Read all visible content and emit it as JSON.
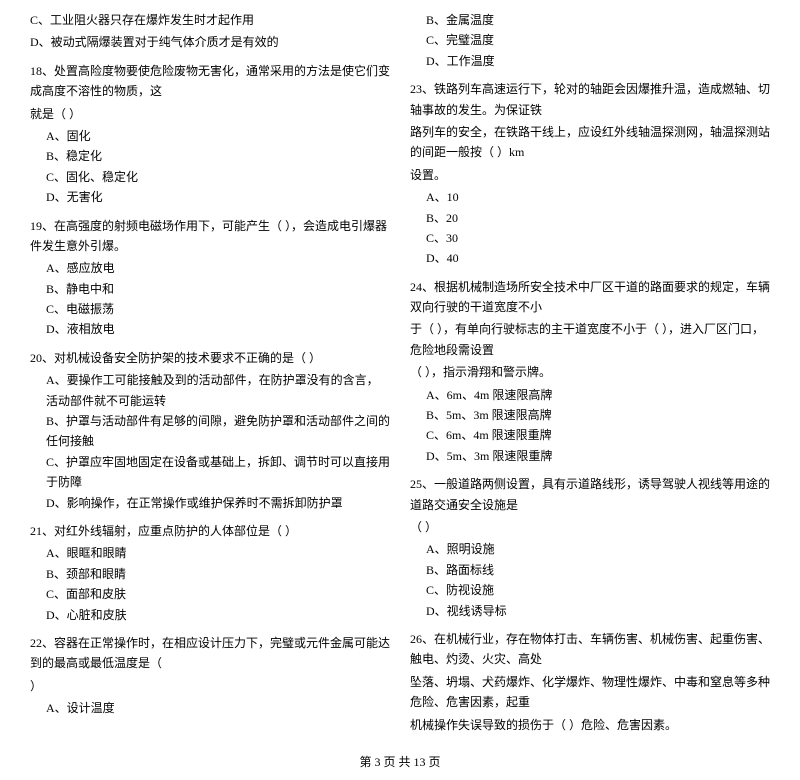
{
  "left_column": [
    {
      "id": "q_c_tool",
      "lines": [
        "C、工业阻火器只存在爆炸发生时才起作用",
        "D、被动式隔爆装置对于纯气体介质才是有效的"
      ],
      "options": []
    },
    {
      "id": "q18",
      "lines": [
        "18、处置高险度物要使危险废物无害化，通常采用的方法是使它们变成高度不溶性的物质，这",
        "就是（  ）"
      ],
      "options": [
        "A、固化",
        "B、稳定化",
        "C、固化、稳定化",
        "D、无害化"
      ]
    },
    {
      "id": "q19",
      "lines": [
        "19、在高强度的射频电磁场作用下，可能产生（    ），会造成电引爆器件发生意外引爆。"
      ],
      "options": [
        "A、感应放电",
        "B、静电中和",
        "C、电磁振荡",
        "D、液相放电"
      ]
    },
    {
      "id": "q20",
      "lines": [
        "20、对机械设备安全防护架的技术要求不正确的是（    ）"
      ],
      "options": [
        "A、要操作工可能接触及到的活动部件，在防护罩没有的含言，活动部件就不可能运转",
        "B、护罩与活动部件有足够的间隙，避免防护罩和活动部件之间的任何接触",
        "C、护罩应牢固地固定在设备或基础上，拆卸、调节时可以直接用于防障",
        "D、影响操作，在正常操作或维护保养时不需拆卸防护罩"
      ]
    },
    {
      "id": "q21",
      "lines": [
        "21、对红外线辐射，应重点防护的人体部位是（    ）"
      ],
      "options": [
        "A、眼眶和眼睛",
        "B、颈部和眼睛",
        "C、面部和皮肤",
        "D、心脏和皮肤"
      ]
    },
    {
      "id": "q22",
      "lines": [
        "22、容器在正常操作时，在相应设计压力下，完璧或元件金属可能达到的最高或最低温度是（",
        "）"
      ],
      "options": [
        "A、设计温度"
      ]
    }
  ],
  "right_column": [
    {
      "id": "q22_cont",
      "lines": [
        "B、金属温度",
        "C、完璧温度",
        "D、工作温度"
      ],
      "options": []
    },
    {
      "id": "q23",
      "lines": [
        "23、铁路列车高速运行下，轮对的轴距会因爆推升温，造成燃轴、切轴事故的发生。为保证铁",
        "路列车的安全，在铁路干线上，应设红外线轴温探测网，轴温探测站的间距一般按（    ）km",
        "设置。"
      ],
      "options": [
        "A、10",
        "B、20",
        "C、30",
        "D、40"
      ]
    },
    {
      "id": "q24",
      "lines": [
        "24、根据机械制造场所安全技术中厂区干道的路面要求的规定，车辆双向行驶的干道宽度不小",
        "于（    ），有单向行驶标志的主干道宽度不小于（    ），进入厂区门口，危险地段需设置",
        "（    ），指示滑翔和警示牌。"
      ],
      "options": [
        "A、6m、4m  限速限高牌",
        "B、5m、3m  限速限高牌",
        "C、6m、4m  限速限重牌",
        "D、5m、3m  限速限重牌"
      ]
    },
    {
      "id": "q25",
      "lines": [
        "25、一般道路两侧设置，具有示道路线形，诱导驾驶人视线等用途的道路交通安全设施是",
        "（    ）"
      ],
      "options": [
        "A、照明设施",
        "B、路面标线",
        "C、防视设施",
        "D、视线诱导标"
      ]
    },
    {
      "id": "q26",
      "lines": [
        "26、在机械行业，存在物体打击、车辆伤害、机械伤害、起重伤害、触电、灼烫、火灾、高处",
        "坠落、坍塌、犬药爆炸、化学爆炸、物理性爆炸、中毒和窒息等多种危险、危害因素，起重",
        "机械操作失误导致的损伤于（    ）危险、危害因素。"
      ],
      "options": []
    }
  ],
  "footer": {
    "text": "第 3 页 共 13 页"
  }
}
